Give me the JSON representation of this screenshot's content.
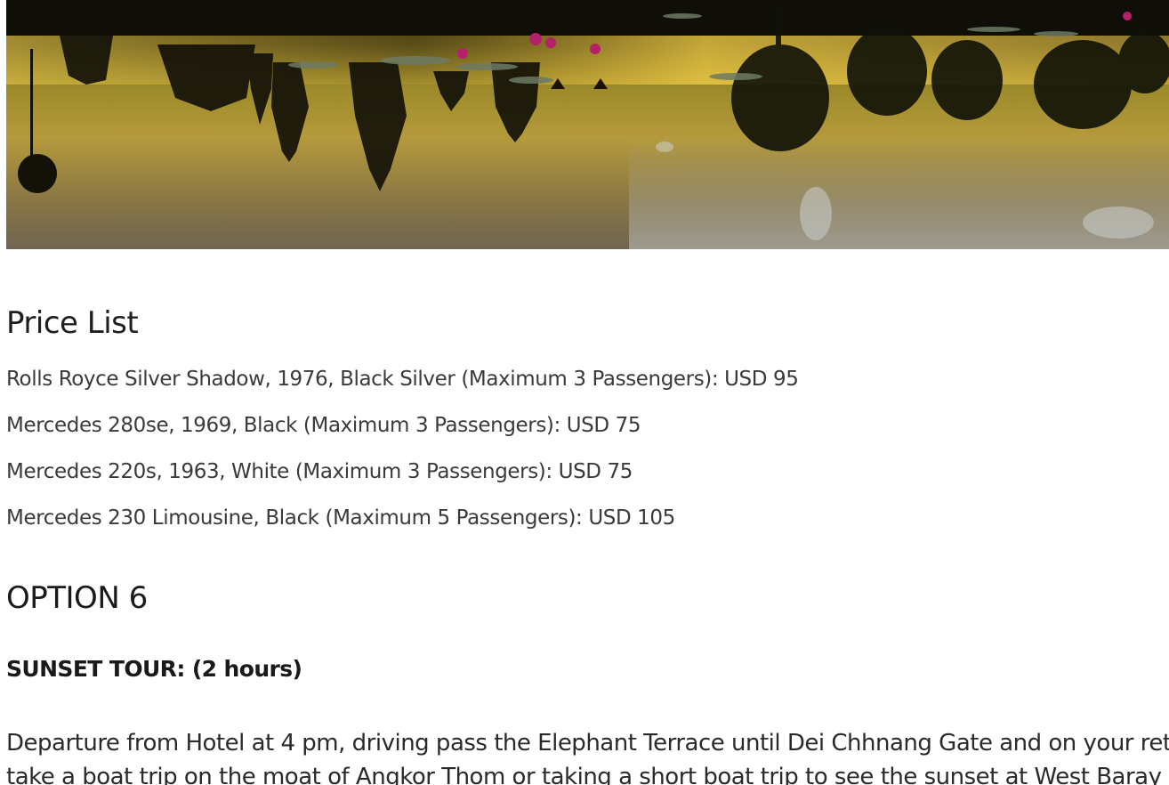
{
  "hero_image": {
    "description_icon": "angkor-wat-sunset-reflection-image"
  },
  "price_list": {
    "title": "Price List",
    "items": [
      "Rolls Royce Silver Shadow, 1976, Black Silver (Maximum 3 Passengers): USD 95",
      "Mercedes 280se, 1969, Black (Maximum 3 Passengers): USD 75",
      "Mercedes 220s, 1963, White (Maximum 3 Passengers): USD 75",
      "Mercedes 230 Limousine, Black (Maximum 5 Passengers): USD 105"
    ]
  },
  "option": {
    "title": "OPTION 6",
    "tour_title": "SUNSET TOUR: (2 hours)",
    "description_lines": [
      "Departure from Hotel at 4 pm, driving pass the Elephant Terrace until Dei Chhnang Gate and on your return",
      "take a boat trip on the moat of Angkor Thom or taking a short boat trip to see the sunset at West Baray"
    ]
  },
  "colors": {
    "background": "#ffffff",
    "heading": "#1e1e1e",
    "body_text": "#3a3a3a"
  }
}
